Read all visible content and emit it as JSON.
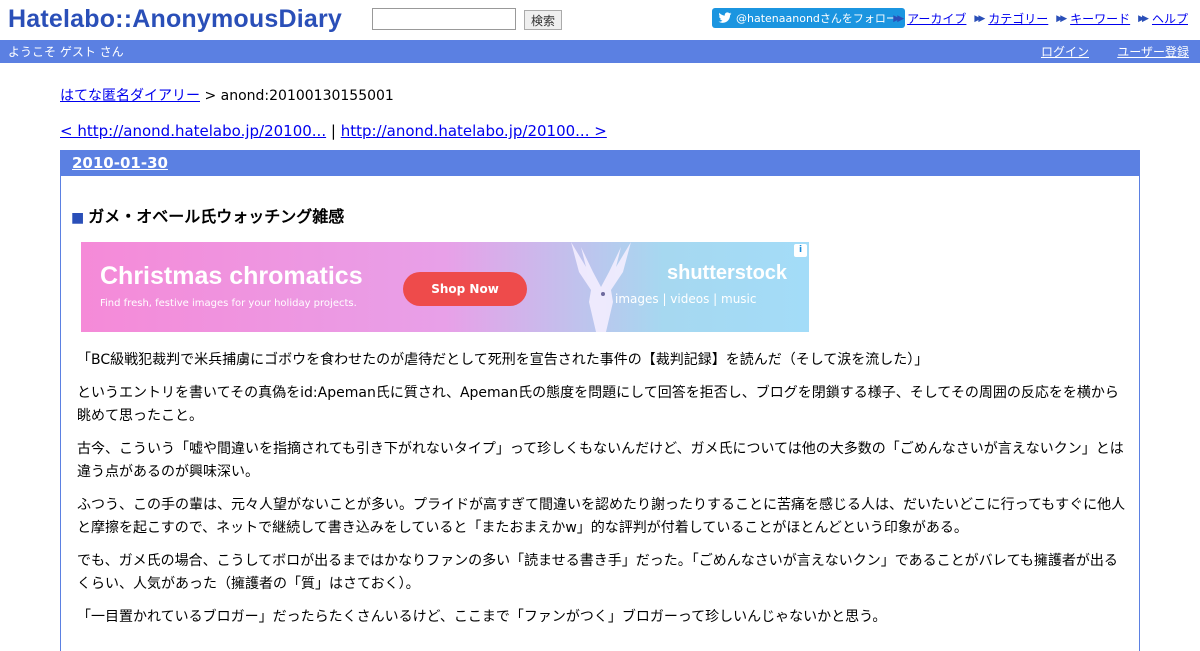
{
  "header": {
    "logo": "Hatelabo::AnonymousDiary",
    "search_value": "",
    "search_button": "検索",
    "twitter_follow": "@hatenaanondさんをフォロー",
    "nav": [
      "アーカイブ",
      "カテゴリー",
      "キーワード",
      "ヘルプ"
    ]
  },
  "userbar": {
    "welcome": "ようこそ ゲスト さん",
    "login": "ログイン",
    "register": "ユーザー登録"
  },
  "breadcrumb": {
    "home": "はてな匿名ダイアリー",
    "separator": " > ",
    "current": "anond:20100130155001"
  },
  "pager": {
    "prev": "< http://anond.hatelabo.jp/20100...",
    "separator": " | ",
    "next": "http://anond.hatelabo.jp/20100... >"
  },
  "entry": {
    "date": "2010-01-30",
    "title_marker": "■",
    "title": "ガメ・オベール氏ウォッチング雑感"
  },
  "ad": {
    "title": "Christmas chromatics",
    "subtitle": "Find fresh, festive images for your holiday projects.",
    "button": "Shop Now",
    "brand": "shutterstock",
    "tags": "images  |  videos  |  music",
    "info": "i"
  },
  "paragraphs": [
    "「BC級戦犯裁判で米兵捕虜にゴボウを食わせたのが虐待だとして死刑を宣告された事件の【裁判記録】を読んだ（そして涙を流した）」",
    "というエントリを書いてその真偽をid:Apeman氏に質され、Apeman氏の態度を問題にして回答を拒否し、ブログを閉鎖する様子、そしてその周囲の反応をを横から眺めて思ったこと。",
    "古今、こういう「嘘や間違いを指摘されても引き下がれないタイプ」って珍しくもないんだけど、ガメ氏については他の大多数の「ごめんなさいが言えないクン」とは違う点があるのが興味深い。",
    "ふつう、この手の輩は、元々人望がないことが多い。プライドが高すぎて間違いを認めたり謝ったりすることに苦痛を感じる人は、だいたいどこに行ってもすぐに他人と摩擦を起こすので、ネットで継続して書き込みをしていると「またおまえかw」的な評判が付着していることがほとんどという印象がある。",
    "でも、ガメ氏の場合、こうしてボロが出るまではかなりファンの多い「読ませる書き手」だった。「ごめんなさいが言えないクン」であることがバレても擁護者が出るくらい、人気があった（擁護者の「質」はさておく）。",
    "「一目置かれているブロガー」だったらたくさんいるけど、ここまで「ファンがつく」ブロガーって珍しいんじゃないかと思う。"
  ]
}
